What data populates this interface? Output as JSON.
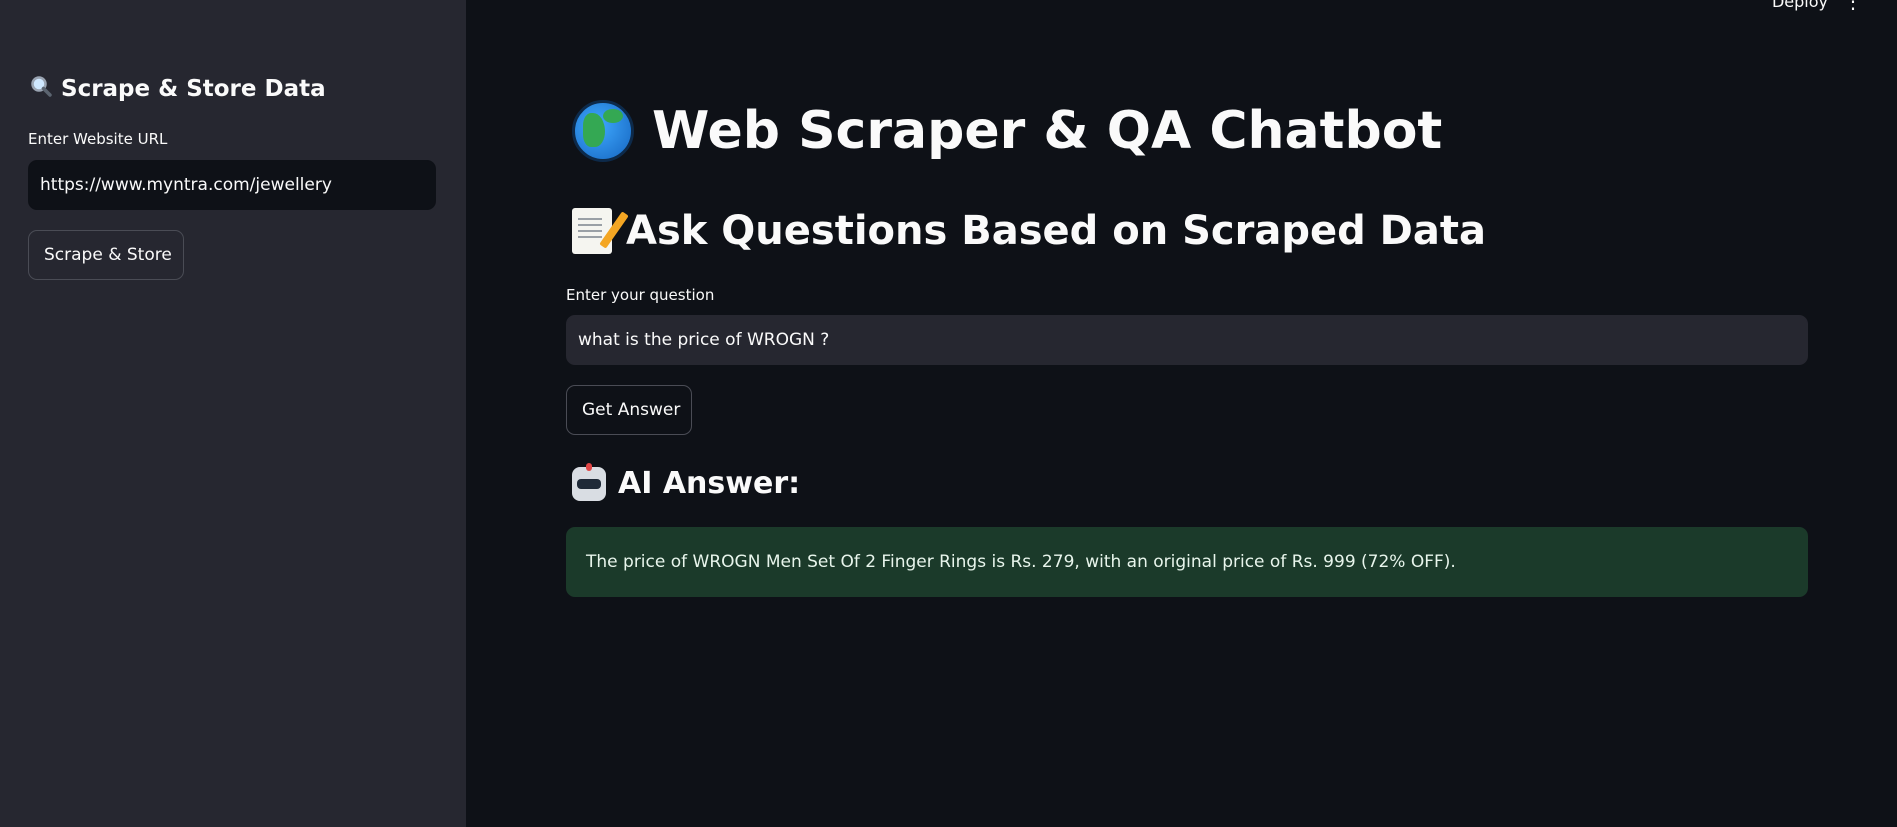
{
  "header": {
    "deploy_label": "Deploy",
    "menu_icon": "kebab-menu-icon"
  },
  "sidebar": {
    "title": "Scrape & Store Data",
    "title_icon": "magnifier-icon",
    "url_label": "Enter Website URL",
    "url_value": "https://www.myntra.com/jewellery",
    "scrape_button_label": "Scrape & Store"
  },
  "main": {
    "title": "Web Scraper & QA Chatbot",
    "title_icon": "globe-icon",
    "section_title": "Ask Questions Based on Scraped Data",
    "section_icon": "memo-icon",
    "question_label": "Enter your question",
    "question_value": "what is the price of WROGN ?",
    "answer_button_label": "Get Answer",
    "answer_heading": "AI Answer:",
    "answer_icon": "robot-icon",
    "answer_text": "The price of WROGN Men Set Of 2 Finger Rings is Rs. 279, with an original price of Rs. 999 (72% OFF)."
  },
  "colors": {
    "background": "#0e1117",
    "sidebar": "#262730",
    "input_background": "#262730",
    "success_background": "#1b3a2a",
    "text": "#fafafa"
  }
}
